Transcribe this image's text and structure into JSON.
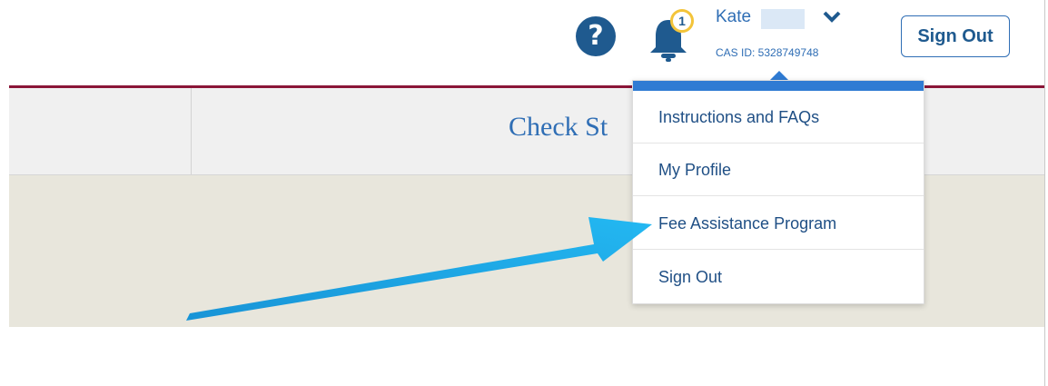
{
  "header": {
    "notification_count": "1",
    "user_name": "Kate",
    "cas_id": "CAS ID: 5328749748",
    "sign_out_label": "Sign Out",
    "accent_color": "#8a1537"
  },
  "nav": {
    "title_partial": "Check St"
  },
  "dropdown": {
    "items": [
      {
        "label": "Instructions and FAQs"
      },
      {
        "label": "My Profile"
      },
      {
        "label": "Fee Assistance Program"
      },
      {
        "label": "Sign Out"
      }
    ]
  },
  "icons": {
    "help": "question-circle-icon",
    "bell": "bell-icon",
    "chevron": "chevron-down-icon",
    "annotation": "blue-arrow"
  },
  "colors": {
    "primary_blue": "#2f6eb5",
    "dark_blue": "#1f5a8f",
    "badge_ring": "#f3c43a",
    "beige": "#e8e6dc",
    "arrow": "#17a9ea"
  }
}
